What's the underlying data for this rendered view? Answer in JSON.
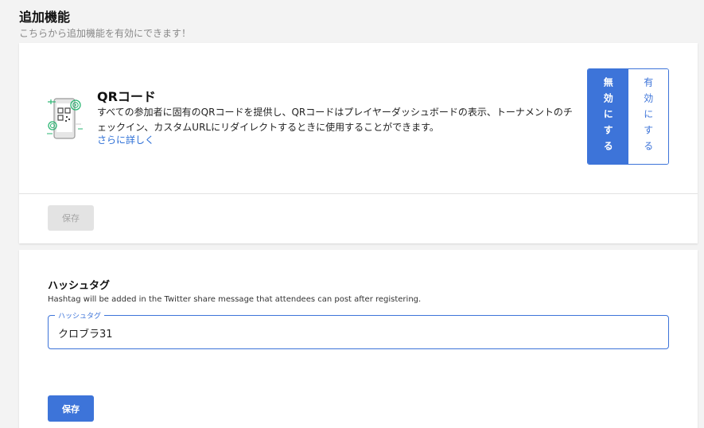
{
  "page": {
    "title": "追加機能",
    "subtitle": "こちらから追加機能を有効にできます！"
  },
  "qr_feature": {
    "title": "QRコード",
    "description": "すべての参加者に固有のQRコードを提供し、QRコードはプレイヤーダッシュボードの表示、トーナメントのチェックイン、カスタムURLにリダイレクトするときに使用することができます。",
    "learn_more": "さらに詳しく",
    "toggle": {
      "disable_label": "無効にする",
      "enable_label": "有効にする",
      "selected": "disable"
    },
    "save_label": "保存",
    "save_disabled": true
  },
  "hashtag": {
    "title": "ハッシュタグ",
    "help": "Hashtag will be added in the Twitter share message that attendees can post after registering.",
    "field_label": "ハッシュタグ",
    "value": "クロブラ31",
    "save_label": "保存"
  },
  "colors": {
    "accent": "#3d74d9",
    "illustration_green": "#2bb673"
  },
  "icons": {
    "qr_feature": "qr-phone-illustration"
  }
}
